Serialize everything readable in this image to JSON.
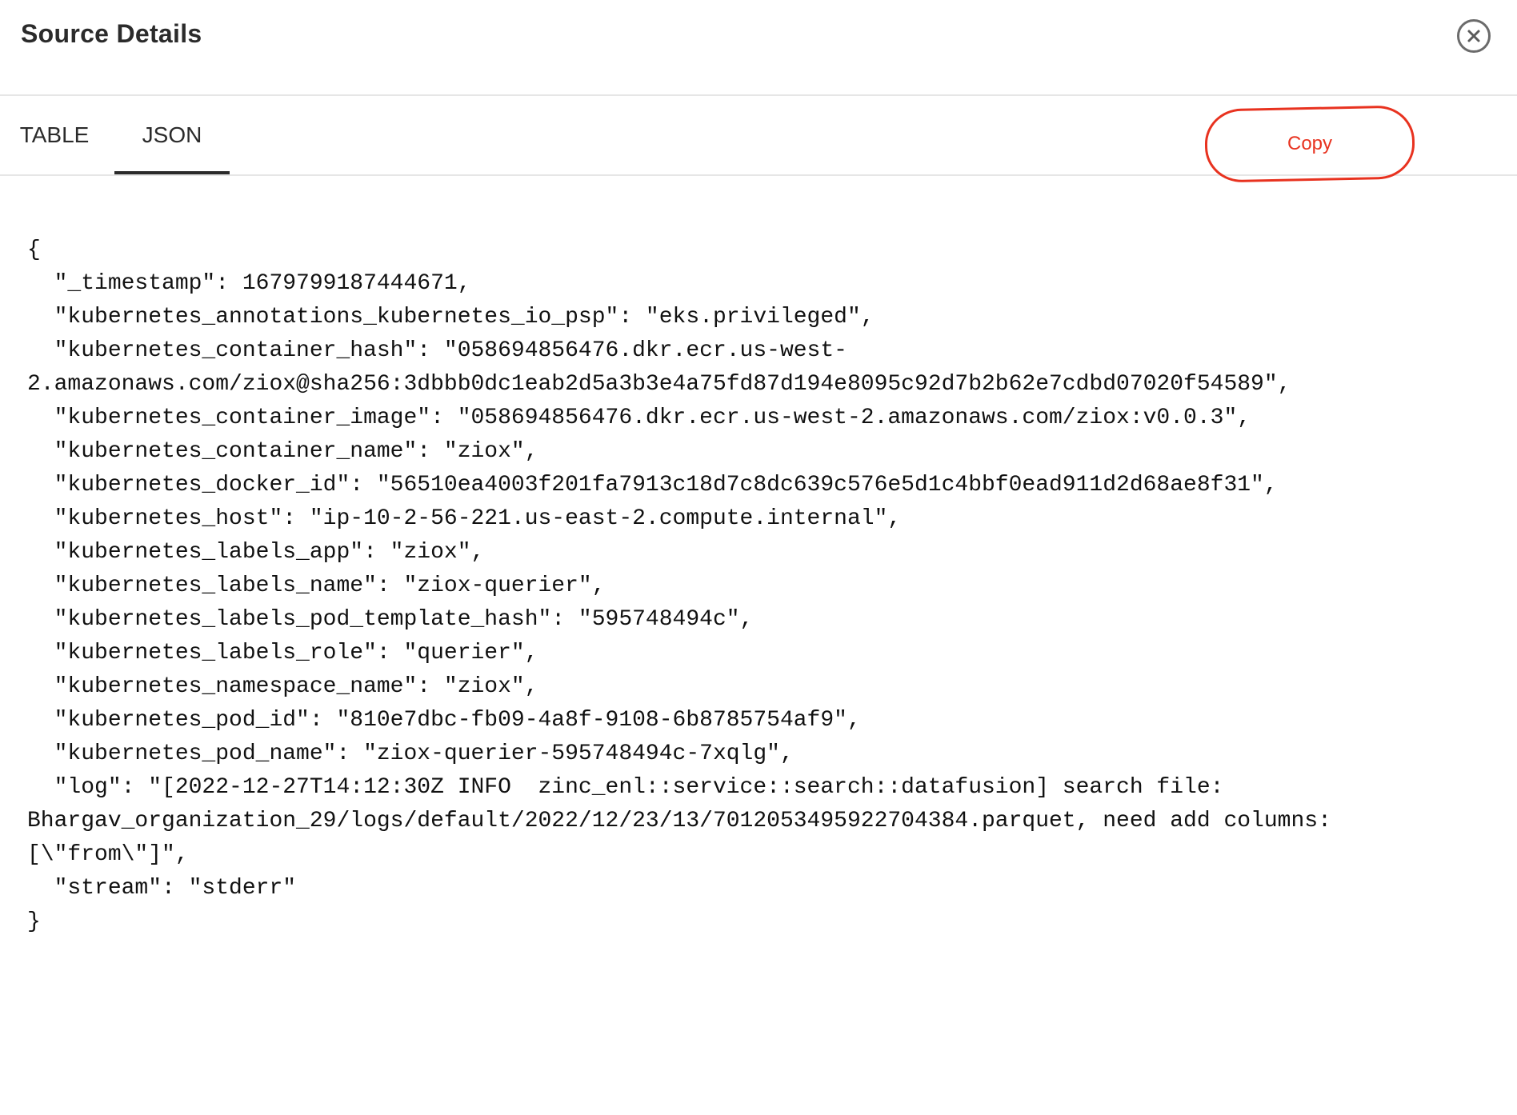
{
  "dialog": {
    "title": "Source Details",
    "close_icon": "close-circle-icon"
  },
  "tabs": [
    {
      "label": "TABLE",
      "active": false
    },
    {
      "label": "JSON",
      "active": true
    }
  ],
  "copy_button": {
    "label": "Copy",
    "annotation_color": "#e8321f"
  },
  "json_lines": [
    "{",
    "  \"_timestamp\": 1679799187444671,",
    "  \"kubernetes_annotations_kubernetes_io_psp\": \"eks.privileged\",",
    "  \"kubernetes_container_hash\": \"058694856476.dkr.ecr.us-west-",
    "2.amazonaws.com/ziox@sha256:3dbbb0dc1eab2d5a3b3e4a75fd87d194e8095c92d7b2b62e7cdbd07020f54589\",",
    "  \"kubernetes_container_image\": \"058694856476.dkr.ecr.us-west-2.amazonaws.com/ziox:v0.0.3\",",
    "  \"kubernetes_container_name\": \"ziox\",",
    "  \"kubernetes_docker_id\": \"56510ea4003f201fa7913c18d7c8dc639c576e5d1c4bbf0ead911d2d68ae8f31\",",
    "  \"kubernetes_host\": \"ip-10-2-56-221.us-east-2.compute.internal\",",
    "  \"kubernetes_labels_app\": \"ziox\",",
    "  \"kubernetes_labels_name\": \"ziox-querier\",",
    "  \"kubernetes_labels_pod_template_hash\": \"595748494c\",",
    "  \"kubernetes_labels_role\": \"querier\",",
    "  \"kubernetes_namespace_name\": \"ziox\",",
    "  \"kubernetes_pod_id\": \"810e7dbc-fb09-4a8f-9108-6b8785754af9\",",
    "  \"kubernetes_pod_name\": \"ziox-querier-595748494c-7xqlg\",",
    "  \"log\": \"[2022-12-27T14:12:30Z INFO  zinc_enl::service::search::datafusion] search file:",
    "Bhargav_organization_29/logs/default/2022/12/23/13/7012053495922704384.parquet, need add columns:",
    "[\\\"from\\\"]\",",
    "  \"stream\": \"stderr\"",
    "}"
  ]
}
